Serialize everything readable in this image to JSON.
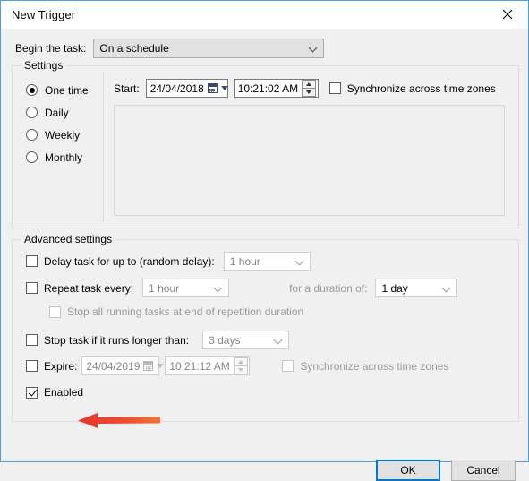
{
  "window": {
    "title": "New Trigger",
    "close_icon": "close-icon",
    "border_color": "#4ca0d8"
  },
  "begin": {
    "label": "Begin the task:",
    "value": "On a schedule"
  },
  "settings": {
    "legend": "Settings",
    "schedule_options": [
      {
        "label": "One time",
        "selected": true
      },
      {
        "label": "Daily",
        "selected": false
      },
      {
        "label": "Weekly",
        "selected": false
      },
      {
        "label": "Monthly",
        "selected": false
      }
    ],
    "start": {
      "label": "Start:",
      "date": "24/04/2018",
      "time": "10:21:02 AM"
    },
    "sync_time_zones": {
      "label": "Synchronize across time zones",
      "checked": false
    }
  },
  "advanced": {
    "legend": "Advanced settings",
    "delay_task": {
      "label": "Delay task for up to (random delay):",
      "checked": false,
      "value": "1 hour"
    },
    "repeat_task": {
      "label": "Repeat task every:",
      "checked": false,
      "value": "1 hour",
      "duration_label": "for a duration of:",
      "duration_value": "1 day"
    },
    "stop_all_running": {
      "label": "Stop all running tasks at end of repetition duration",
      "checked": false
    },
    "stop_task_longer": {
      "label": "Stop task if it runs longer than:",
      "checked": false,
      "value": "3 days"
    },
    "expire": {
      "label": "Expire:",
      "checked": false,
      "date": "24/04/2019",
      "time": "10:21:12 AM",
      "sync_label": "Synchronize across time zones",
      "sync_checked": false
    },
    "enabled": {
      "label": "Enabled",
      "checked": true
    }
  },
  "annotation": {
    "arrow_name": "red-arrow-pointing-to-enabled",
    "color_start": "#ee3b2b",
    "color_end": "#f07030"
  },
  "buttons": {
    "ok": "OK",
    "cancel": "Cancel",
    "ok_focus_color": "#0078d7"
  }
}
